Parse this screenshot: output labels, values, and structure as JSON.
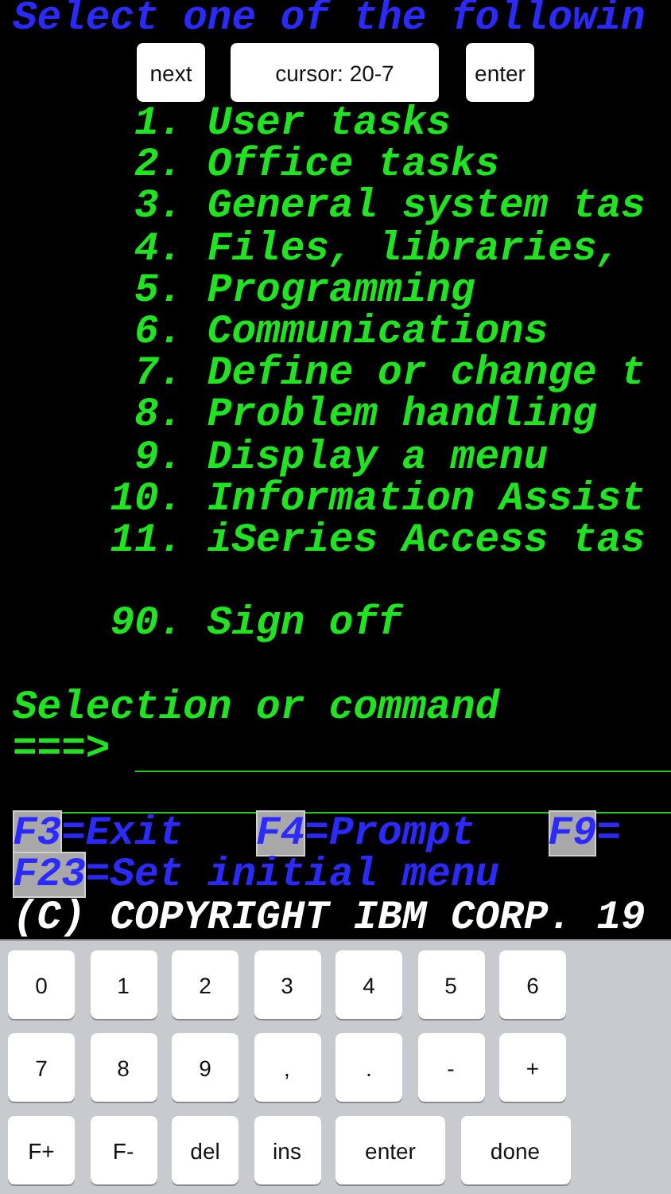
{
  "toolbar": {
    "next_button": "next",
    "cursor_label": "cursor: 20-7",
    "enter_button": "enter"
  },
  "terminal": {
    "header": "Select one of the followin",
    "menu": [
      {
        "number": "1.",
        "label": "User tasks"
      },
      {
        "number": "2.",
        "label": "Office tasks"
      },
      {
        "number": "3.",
        "label": "General system tas"
      },
      {
        "number": "4.",
        "label": "Files, libraries,"
      },
      {
        "number": "5.",
        "label": "Programming"
      },
      {
        "number": "6.",
        "label": "Communications"
      },
      {
        "number": "7.",
        "label": "Define or change t"
      },
      {
        "number": "8.",
        "label": "Problem handling"
      },
      {
        "number": "9.",
        "label": "Display a menu"
      },
      {
        "number": "10.",
        "label": "Information Assist"
      },
      {
        "number": "11.",
        "label": "iSeries Access tas"
      }
    ],
    "signoff": {
      "number": "90.",
      "label": "Sign off"
    },
    "prompt": "Selection or command",
    "command_arrow": "===>",
    "function_keys": [
      [
        {
          "key": "F3",
          "text": "=Exit"
        },
        {
          "key": "F4",
          "text": "=Prompt"
        },
        {
          "key": "F9",
          "text": "="
        }
      ],
      [
        {
          "key": "F23",
          "text": "=Set initial menu"
        }
      ]
    ],
    "copyright": "(C) COPYRIGHT IBM CORP. 19"
  },
  "keypad": {
    "rows": [
      [
        "0",
        "1",
        "2",
        "3",
        "4",
        "5",
        "6"
      ],
      [
        "7",
        "8",
        "9",
        ",",
        ".",
        "-",
        "+"
      ],
      [
        "F+",
        "F-",
        "del",
        "ins"
      ]
    ],
    "action_keys": [
      "enter",
      "done"
    ]
  }
}
